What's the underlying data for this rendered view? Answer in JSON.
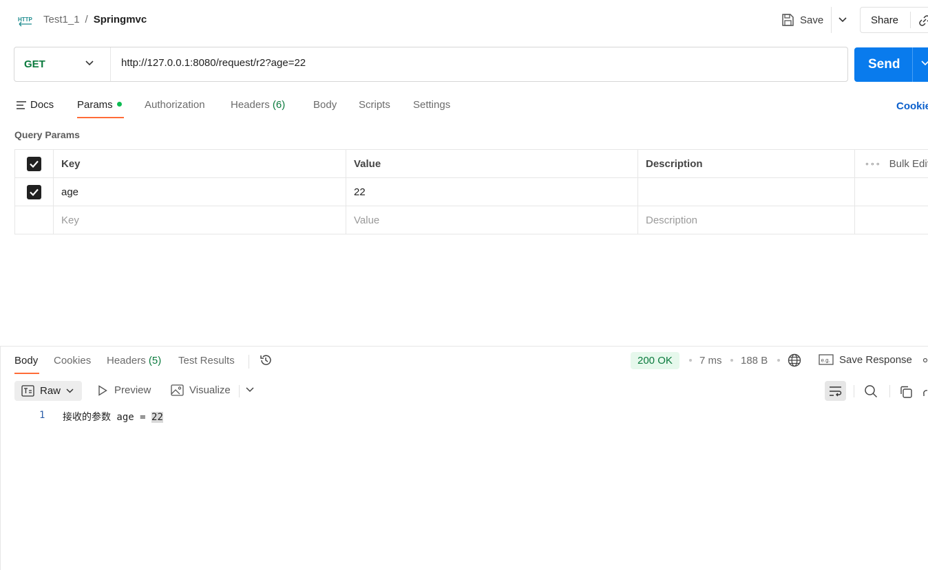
{
  "header": {
    "breadcrumb_parent": "Test1_1",
    "breadcrumb_sep": "/",
    "breadcrumb_current": "Springmvc",
    "save_label": "Save",
    "share_label": "Share"
  },
  "request": {
    "method": "GET",
    "url": "http://127.0.0.1:8080/request/r2?age=22",
    "send_label": "Send"
  },
  "request_tabs": {
    "docs": "Docs",
    "params": "Params",
    "authorization": "Authorization",
    "headers": "Headers",
    "headers_count": "(6)",
    "body": "Body",
    "scripts": "Scripts",
    "settings": "Settings",
    "cookies": "Cookie"
  },
  "query_params": {
    "title": "Query Params",
    "columns": {
      "key": "Key",
      "value": "Value",
      "description": "Description",
      "bulk_edit": "Bulk Edit"
    },
    "rows": [
      {
        "key": "age",
        "value": "22",
        "description": ""
      }
    ],
    "placeholders": {
      "key": "Key",
      "value": "Value",
      "description": "Description"
    }
  },
  "response_tabs": {
    "body": "Body",
    "cookies": "Cookies",
    "headers": "Headers",
    "headers_count": "(5)",
    "test_results": "Test Results"
  },
  "response_meta": {
    "status": "200 OK",
    "time": "7 ms",
    "size": "188 B",
    "save_response": "Save Response"
  },
  "format_bar": {
    "raw": "Raw",
    "preview": "Preview",
    "visualize": "Visualize"
  },
  "response_body": {
    "line_number": "1",
    "text_before": "接收的参数 age = ",
    "text_highlight": "22"
  },
  "colors": {
    "accent": "#ff6c37",
    "send": "#097bed",
    "method_get": "#0a7a3d",
    "status_ok_bg": "#e6f8ec"
  }
}
